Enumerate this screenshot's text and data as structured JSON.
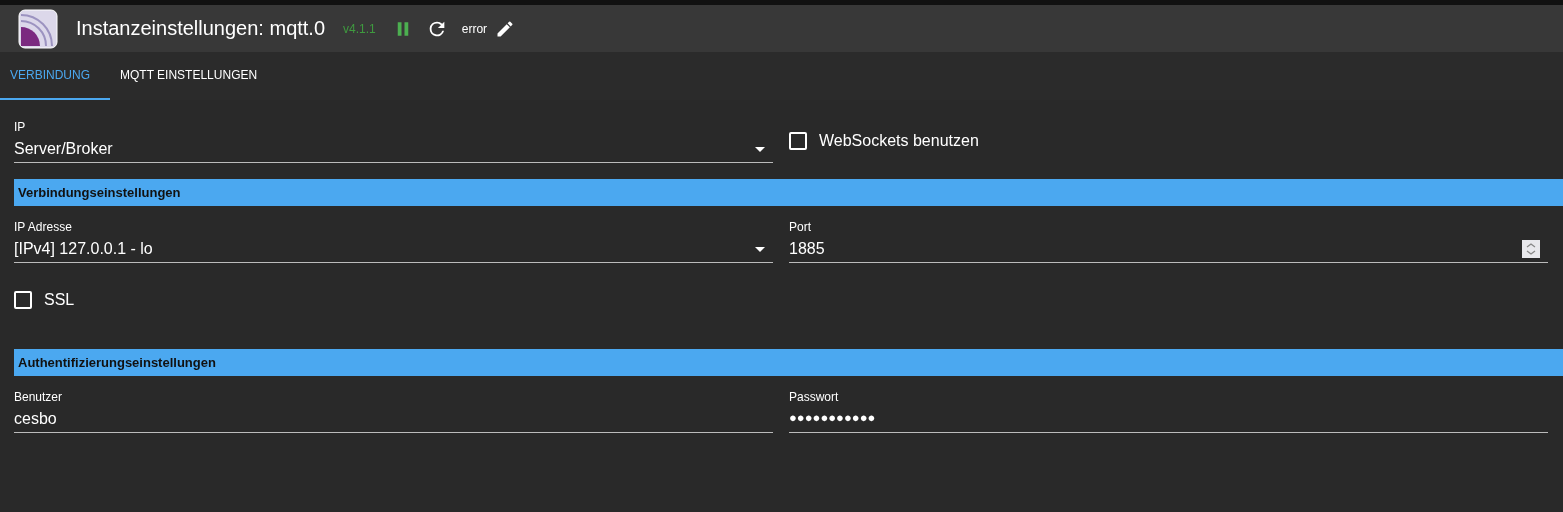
{
  "header": {
    "title": "Instanzeinstellungen: mqtt.0",
    "version": "v4.1.1",
    "paused": false,
    "status": "error"
  },
  "tabs": [
    {
      "label": "VERBINDUNG",
      "selected": true
    },
    {
      "label": "MQTT EINSTELLUNGEN",
      "selected": false
    }
  ],
  "ip_select": {
    "label": "IP",
    "value": "Server/Broker"
  },
  "websockets": {
    "label": "WebSockets benutzen",
    "checked": false
  },
  "sections": [
    {
      "title": "Verbindungseinstellungen",
      "fields": [
        {
          "kind": "select",
          "label": "IP Adresse",
          "value": "[IPv4] 127.0.0.1 - lo"
        },
        {
          "kind": "number",
          "label": "Port",
          "value": "1885"
        }
      ],
      "checkbox": {
        "label": "SSL",
        "checked": false
      }
    },
    {
      "title": "Authentifizierungseinstellungen",
      "fields": [
        {
          "kind": "text",
          "label": "Benutzer",
          "value": "cesbo"
        },
        {
          "kind": "password",
          "label": "Passwort",
          "value": "●●●●●●●●●●●"
        }
      ]
    }
  ]
}
